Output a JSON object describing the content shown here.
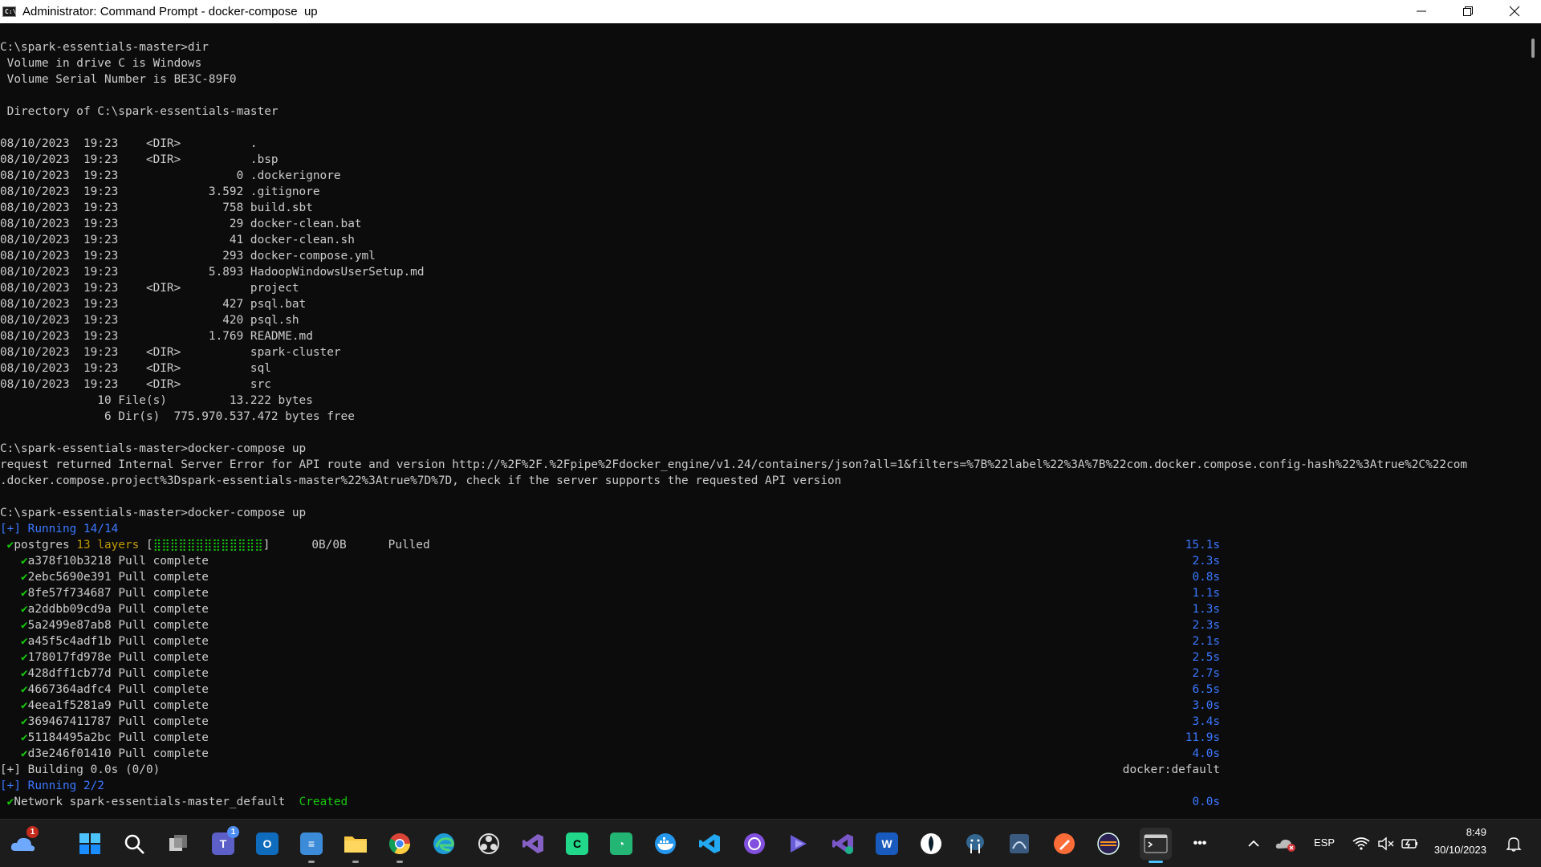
{
  "window": {
    "title": "Administrator: Command Prompt - docker-compose  up",
    "icon_label": "C:\\"
  },
  "console": {
    "lines": [
      {
        "text": "C:\\spark-essentials-master>dir",
        "color": "default"
      },
      {
        "text": " Volume in drive C is Windows",
        "color": "default"
      },
      {
        "text": " Volume Serial Number is BE3C-89F0",
        "color": "default"
      },
      {
        "text": "",
        "color": "default"
      },
      {
        "text": " Directory of C:\\spark-essentials-master",
        "color": "default"
      },
      {
        "text": "",
        "color": "default"
      },
      {
        "text": "08/10/2023  19:23    <DIR>          .",
        "color": "default"
      },
      {
        "text": "08/10/2023  19:23    <DIR>          .bsp",
        "color": "default"
      },
      {
        "text": "08/10/2023  19:23                 0 .dockerignore",
        "color": "default"
      },
      {
        "text": "08/10/2023  19:23             3.592 .gitignore",
        "color": "default"
      },
      {
        "text": "08/10/2023  19:23               758 build.sbt",
        "color": "default"
      },
      {
        "text": "08/10/2023  19:23                29 docker-clean.bat",
        "color": "default"
      },
      {
        "text": "08/10/2023  19:23                41 docker-clean.sh",
        "color": "default"
      },
      {
        "text": "08/10/2023  19:23               293 docker-compose.yml",
        "color": "default"
      },
      {
        "text": "08/10/2023  19:23             5.893 HadoopWindowsUserSetup.md",
        "color": "default"
      },
      {
        "text": "08/10/2023  19:23    <DIR>          project",
        "color": "default"
      },
      {
        "text": "08/10/2023  19:23               427 psql.bat",
        "color": "default"
      },
      {
        "text": "08/10/2023  19:23               420 psql.sh",
        "color": "default"
      },
      {
        "text": "08/10/2023  19:23             1.769 README.md",
        "color": "default"
      },
      {
        "text": "08/10/2023  19:23    <DIR>          spark-cluster",
        "color": "default"
      },
      {
        "text": "08/10/2023  19:23    <DIR>          sql",
        "color": "default"
      },
      {
        "text": "08/10/2023  19:23    <DIR>          src",
        "color": "default"
      },
      {
        "text": "              10 File(s)         13.222 bytes",
        "color": "default"
      },
      {
        "text": "               6 Dir(s)  775.970.537.472 bytes free",
        "color": "default"
      },
      {
        "text": "",
        "color": "default"
      },
      {
        "text": "C:\\spark-essentials-master>docker-compose up",
        "color": "default"
      },
      {
        "text": "request returned Internal Server Error for API route and version http://%2F%2F.%2Fpipe%2Fdocker_engine/v1.24/containers/json?all=1&filters=%7B%22label%22%3A%7B%22com.docker.compose.config-hash%22%3Atrue%2C%22com",
        "color": "default"
      },
      {
        "text": ".docker.compose.project%3Dspark-essentials-master%22%3Atrue%7D%7D, check if the server supports the requested API version",
        "color": "default"
      },
      {
        "text": "",
        "color": "default"
      },
      {
        "text": "C:\\spark-essentials-master>docker-compose up",
        "color": "default"
      }
    ],
    "running_header": "[+] Running 14/14",
    "postgres": {
      "check": "✔",
      "name": "postgres",
      "layers": "13 layers",
      "bar_open": "[",
      "bar_fill": "⣿⣿⣿⣿⣿⣿⣿⣿⣿⣿⣿⣿⣿",
      "bar_close": "]",
      "size": "0B/0B",
      "status": "Pulled",
      "time": "15.1s"
    },
    "layers": [
      {
        "id": "a378f10b3218",
        "status": "Pull complete",
        "time": "2.3s"
      },
      {
        "id": "2ebc5690e391",
        "status": "Pull complete",
        "time": "0.8s"
      },
      {
        "id": "8fe57f734687",
        "status": "Pull complete",
        "time": "1.1s"
      },
      {
        "id": "a2ddbb09cd9a",
        "status": "Pull complete",
        "time": "1.3s"
      },
      {
        "id": "5a2499e87ab8",
        "status": "Pull complete",
        "time": "2.3s"
      },
      {
        "id": "a45f5c4adf1b",
        "status": "Pull complete",
        "time": "2.1s"
      },
      {
        "id": "178017fd978e",
        "status": "Pull complete",
        "time": "2.5s"
      },
      {
        "id": "428dff1cb77d",
        "status": "Pull complete",
        "time": "2.7s"
      },
      {
        "id": "4667364adfc4",
        "status": "Pull complete",
        "time": "6.5s"
      },
      {
        "id": "4eea1f5281a9",
        "status": "Pull complete",
        "time": "3.0s"
      },
      {
        "id": "369467411787",
        "status": "Pull complete",
        "time": "3.4s"
      },
      {
        "id": "51184495a2bc",
        "status": "Pull complete",
        "time": "11.9s"
      },
      {
        "id": "d3e246f01410",
        "status": "Pull complete",
        "time": "4.0s"
      }
    ],
    "building": {
      "text": "[+] Building 0.0s (0/0)",
      "right": "docker:default"
    },
    "running2_header": "[+] Running 2/2",
    "network": {
      "check": "✔",
      "text": "Network spark-essentials-master_default",
      "status": "Created",
      "time": "0.0s"
    }
  },
  "taskbar": {
    "weather_badge": "1",
    "teams_badge": "1",
    "apps": [
      {
        "name": "start-button",
        "icon": "windows-logo"
      },
      {
        "name": "search-button",
        "icon": "search-icon"
      },
      {
        "name": "task-view-button",
        "icon": "task-view-icon"
      },
      {
        "name": "teams-chat",
        "icon": "chat-icon"
      },
      {
        "name": "outlook",
        "icon": "outlook-icon"
      },
      {
        "name": "notepad",
        "icon": "notepad-icon"
      },
      {
        "name": "file-explorer",
        "icon": "folder-icon"
      },
      {
        "name": "chrome",
        "icon": "chrome-icon"
      },
      {
        "name": "edge",
        "icon": "edge-icon"
      },
      {
        "name": "obs",
        "icon": "obs-icon"
      },
      {
        "name": "visual-studio",
        "icon": "visual-studio-icon"
      },
      {
        "name": "pycharm",
        "icon": "ide-icon"
      },
      {
        "name": "datagrip",
        "icon": "datagrip-icon"
      },
      {
        "name": "docker",
        "icon": "docker-icon"
      },
      {
        "name": "vscode",
        "icon": "vscode-icon"
      },
      {
        "name": "github-desktop",
        "icon": "github-icon"
      },
      {
        "name": "power-automate",
        "icon": "power-automate-icon"
      },
      {
        "name": "visual-studio-installer",
        "icon": "vs-installer-icon"
      },
      {
        "name": "word",
        "icon": "word-icon"
      },
      {
        "name": "mongodb-compass",
        "icon": "mongodb-icon"
      },
      {
        "name": "pgadmin",
        "icon": "postgres-icon"
      },
      {
        "name": "sql-server",
        "icon": "sql-server-icon"
      },
      {
        "name": "postman",
        "icon": "postman-icon"
      },
      {
        "name": "eclipse",
        "icon": "eclipse-icon"
      },
      {
        "name": "terminal",
        "icon": "terminal-icon"
      }
    ],
    "overflow": "•••",
    "tray": {
      "lang": "ESP",
      "time": "8:49",
      "date": "30/10/2023"
    }
  },
  "colors": {
    "console_bg": "#0c0c0c",
    "console_fg": "#cccccc",
    "blue": "#3b78ff",
    "green": "#16c60c",
    "yellow": "#c19c00",
    "taskbar_bg": "#1c1c1c"
  }
}
